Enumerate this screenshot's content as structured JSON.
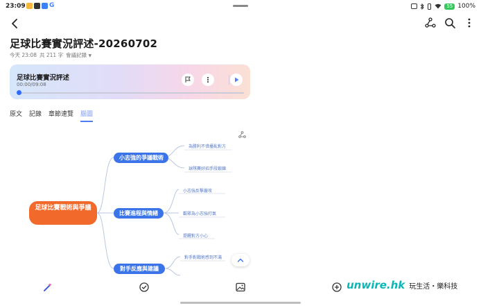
{
  "status_bar": {
    "time": "23:09",
    "battery": "100%",
    "battery_level": "55"
  },
  "header": {
    "title": "足球比賽實況評述-20260702",
    "meta": {
      "date": "今天 23:08",
      "word_count": "共 211 字",
      "category": "會議記錄"
    }
  },
  "player": {
    "title": "足球比賽實況評述",
    "time": "00:00/09:08",
    "progress": 0
  },
  "tabs": [
    {
      "label": "原文",
      "active": false
    },
    {
      "label": "記錄",
      "active": false
    },
    {
      "label": "章節速覽",
      "active": false
    },
    {
      "label": "腦圖",
      "active": true
    }
  ],
  "mindmap": {
    "root": "足球比賽戰術與爭議",
    "branches": [
      {
        "label": "小志強的爭議戰術",
        "leaves": [
          "為勝利不惜擾亂對方",
          "球隊賽好招手段鍛鍊"
        ]
      },
      {
        "label": "比賽進程與情緒",
        "leaves": [
          "小志強反擊嚴攻",
          "觀眾為小志強打氣",
          "提醒對方小心"
        ]
      },
      {
        "label": "對手反應與建議",
        "leaves": [
          "對手對戰術感到不滿"
        ]
      }
    ]
  },
  "watermark": {
    "brand": "unwire.hk",
    "sub": "玩生活・樂科技"
  },
  "colors": {
    "accent": "#3b74e8",
    "root": "#f26a2b",
    "leaf_text": "#5579c9"
  }
}
